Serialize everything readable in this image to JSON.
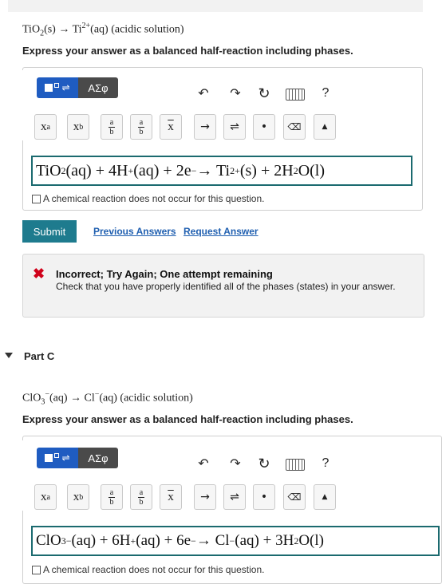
{
  "partB": {
    "question_formula": "TiO₂(s) → Ti²⁺(aq) (acidic solution)",
    "instruction": "Express your answer as a balanced half-reaction including phases.",
    "answer_equation": "TiO₂(aq) + 4H⁺(aq) + 2e⁻ → Ti²⁺(s) + 2H₂O(l)",
    "no_reaction_label": "A chemical reaction does not occur for this question.",
    "submit_label": "Submit",
    "previous_answers_label": "Previous Answers",
    "request_answer_label": "Request Answer",
    "feedback": {
      "title": "Incorrect; Try Again; One attempt remaining",
      "message": "Check that you have properly identified all of the phases (states) in your answer."
    }
  },
  "partC": {
    "label": "Part C",
    "question_formula": "ClO₃⁻(aq) → Cl⁻(aq) (acidic solution)",
    "instruction": "Express your answer as a balanced half-reaction including phases.",
    "answer_equation": "ClO₃⁻(aq) + 6H⁺(aq) + 6e⁻ → Cl⁻(aq) + 3H₂O(l)",
    "no_reaction_label": "A chemical reaction does not occur for this question."
  },
  "toolbar": {
    "greek_label": "ΑΣφ",
    "help_label": "?",
    "icons": [
      "templates-icon",
      "undo-icon",
      "redo-icon",
      "reset-icon",
      "keyboard-icon",
      "help-icon"
    ],
    "keys": [
      "superscript",
      "subscript",
      "fraction",
      "mixed-fraction",
      "overline",
      "reaction-arrow",
      "equilibrium-arrow",
      "dot",
      "backspace",
      "keyboard-toggle"
    ]
  },
  "colors": {
    "accent": "#1f5cc1",
    "submit": "#1e7b8e",
    "link": "#1f5fb0",
    "error": "#d0021b",
    "answer_border": "#1b6a6f"
  }
}
